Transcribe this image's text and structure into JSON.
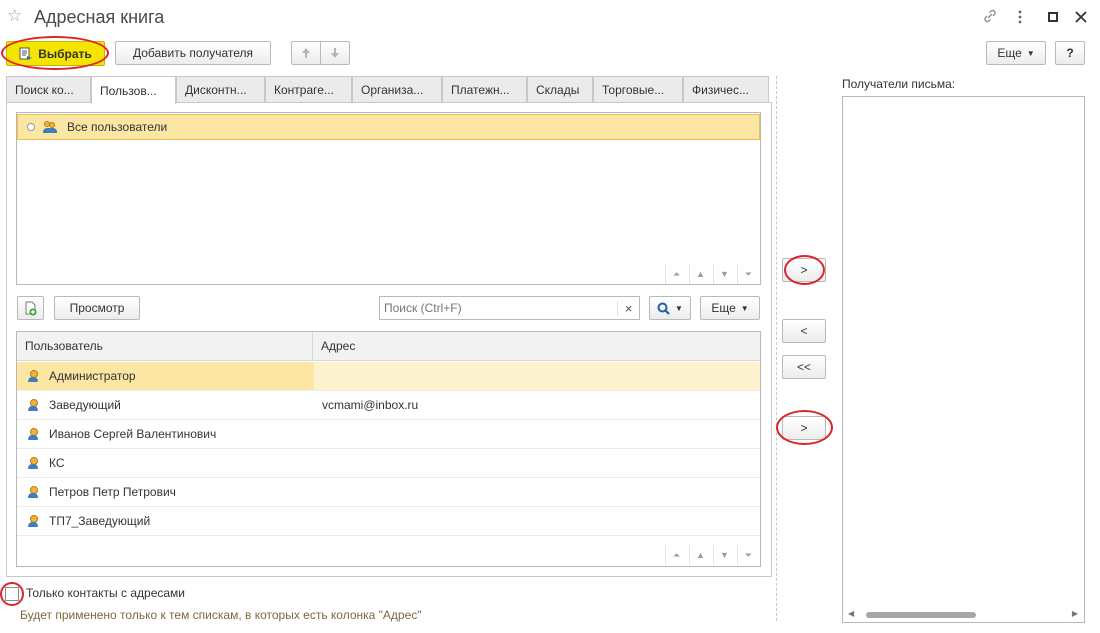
{
  "window": {
    "title": "Адресная книга",
    "icons": [
      "star-icon",
      "link-icon",
      "more-vertical-icon",
      "maximize-icon",
      "close-icon"
    ]
  },
  "toolbar": {
    "select_label": "Выбрать",
    "add_recipient_label": "Добавить получателя",
    "more_label": "Еще",
    "help_label": "?"
  },
  "tabs": [
    {
      "label": "Поиск ко..."
    },
    {
      "label": "Пользов..."
    },
    {
      "label": "Дисконтн..."
    },
    {
      "label": "Контраге..."
    },
    {
      "label": "Организа..."
    },
    {
      "label": "Платежн..."
    },
    {
      "label": "Склады"
    },
    {
      "label": "Торговые..."
    },
    {
      "label": "Физичес..."
    }
  ],
  "active_tab": 1,
  "tree": {
    "items": [
      {
        "label": "Все пользователи"
      }
    ]
  },
  "list_toolbar": {
    "view_label": "Просмотр",
    "search_placeholder": "Поиск (Ctrl+F)",
    "clear_label": "×",
    "more_label": "Еще"
  },
  "table": {
    "columns": [
      "Пользователь",
      "Адрес"
    ],
    "rows": [
      {
        "user": "Администратор",
        "address": ""
      },
      {
        "user": "Заведующий",
        "address": "vcmami@inbox.ru"
      },
      {
        "user": "Иванов Сергей Валентинович",
        "address": ""
      },
      {
        "user": "КС",
        "address": ""
      },
      {
        "user": "Петров Петр Петрович",
        "address": ""
      },
      {
        "user": "ТП7_Заведующий",
        "address": ""
      }
    ],
    "selected_row": 0
  },
  "transfer": {
    "add_tree_label": ">",
    "remove_label": "<",
    "remove_all_label": "<<",
    "add_list_label": ">"
  },
  "recipients": {
    "label": "Получатели письма:"
  },
  "footer": {
    "only_with_addresses_label": "Только контакты с адресами",
    "only_with_addresses_checked": false,
    "hint": "Будет применено только к тем спискам, в которых есть колонка \"Адрес\""
  },
  "colors": {
    "select_button": "#f5e400",
    "selection_row": "#fbe6a3",
    "highlight_ring": "#d9252b",
    "hint_text": "#7a6a43"
  }
}
